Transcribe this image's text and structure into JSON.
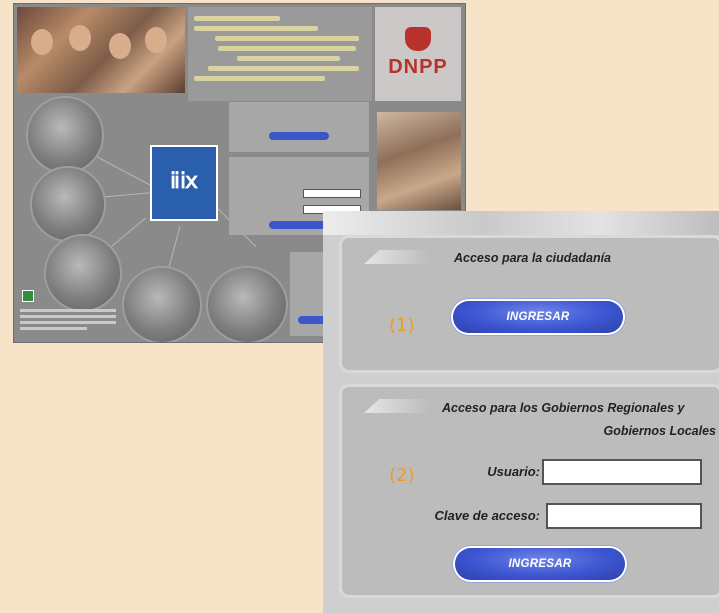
{
  "background_screenshot": {
    "logo_text": "DNPP"
  },
  "ciudadania": {
    "title": "Acceso para la ciudadanía",
    "button_label": "INGRESAR",
    "marker": "(1)"
  },
  "gobiernos": {
    "title_line1": "Acceso para los Gobiernos Regionales y",
    "title_line2": "Gobiernos Locales",
    "usuario_label": "Usuario:",
    "usuario_value": "",
    "clave_label": "Clave de acceso:",
    "clave_value": "",
    "button_label": "INGRESAR",
    "marker": "(2)"
  },
  "colors": {
    "page_background": "#f7e3c8",
    "button_blue": "#3d56d2",
    "marker_orange": "#f39a22",
    "logo_red": "#b8322c"
  }
}
